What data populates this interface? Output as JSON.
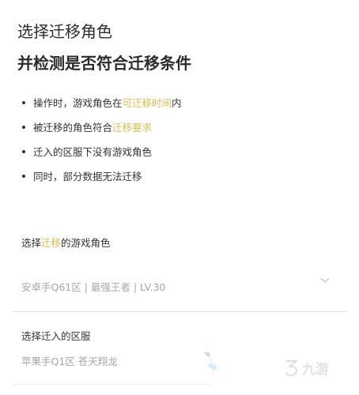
{
  "header": {
    "title_line1": "选择迁移角色",
    "title_line2": "并检测是否符合迁移条件"
  },
  "rules": [
    {
      "before": "操作时，游戏角色在",
      "highlight": "可迁移时间",
      "after": "内"
    },
    {
      "before": "被迁移的角色符合",
      "highlight": "迁移要求",
      "after": ""
    },
    {
      "before": "迁入的区服下没有游戏角色",
      "highlight": "",
      "after": ""
    },
    {
      "before": "同时，部分数据无法迁移",
      "highlight": "",
      "after": ""
    }
  ],
  "role_section": {
    "label_before": "选择",
    "label_highlight": "迁移",
    "label_after": "的游戏角色",
    "selected_value": "安卓手Q61区 | 最强王者 | LV.30"
  },
  "server_section": {
    "label": "选择迁入的区服",
    "selected_value": "苹果手Q1区 苍天翔龙"
  },
  "watermark": {
    "text": "九游",
    "icon": "jiuyou-logo-icon"
  },
  "colors": {
    "highlight": "#d8c04a",
    "placeholder": "#a6a6a6",
    "text": "#333333"
  }
}
